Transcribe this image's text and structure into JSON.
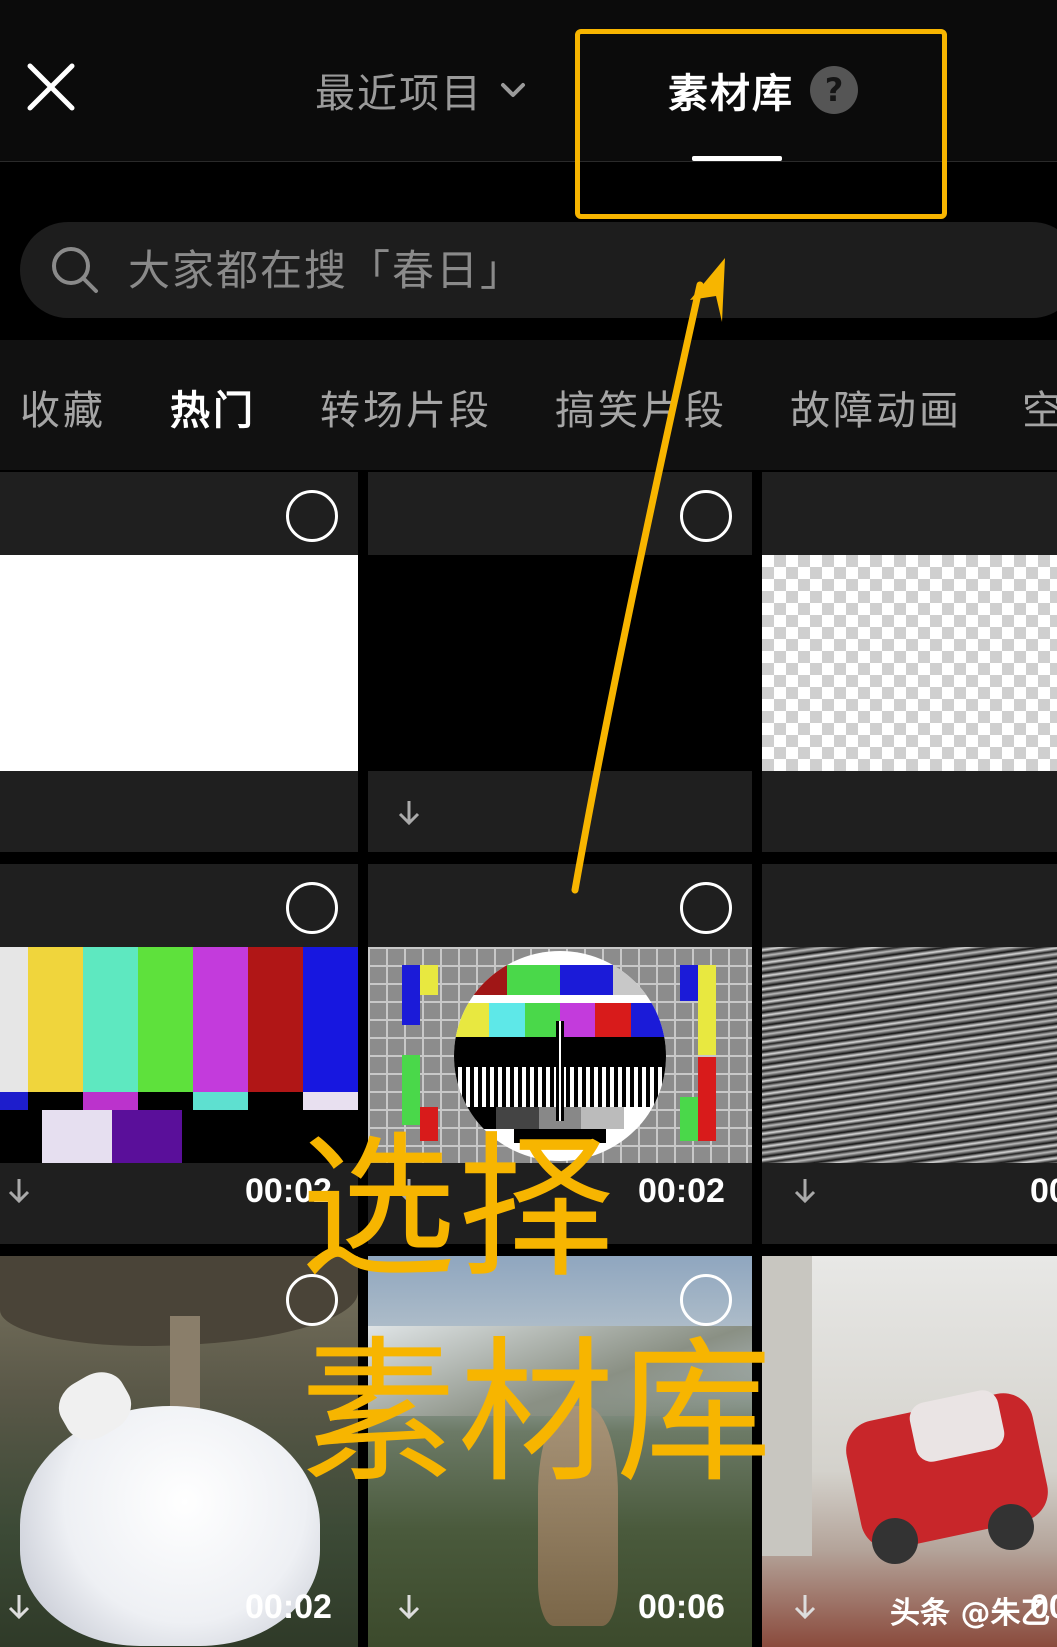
{
  "header": {
    "recent_tab_label": "最近项目",
    "library_tab_label": "素材库",
    "help_symbol": "?"
  },
  "search": {
    "placeholder": "大家都在搜「春日」"
  },
  "categories": [
    "收藏",
    "热门",
    "转场片段",
    "搞笑片段",
    "故障动画",
    "空"
  ],
  "active_category": "热门",
  "grid": {
    "durations": [
      "00:02",
      "00:02",
      "00",
      "00:02",
      "00:06",
      "00"
    ]
  },
  "annotation": {
    "line1": "选择",
    "line2": "素材库",
    "highlight_color": "#f7b500"
  },
  "watermark": "头条 @朱乙"
}
